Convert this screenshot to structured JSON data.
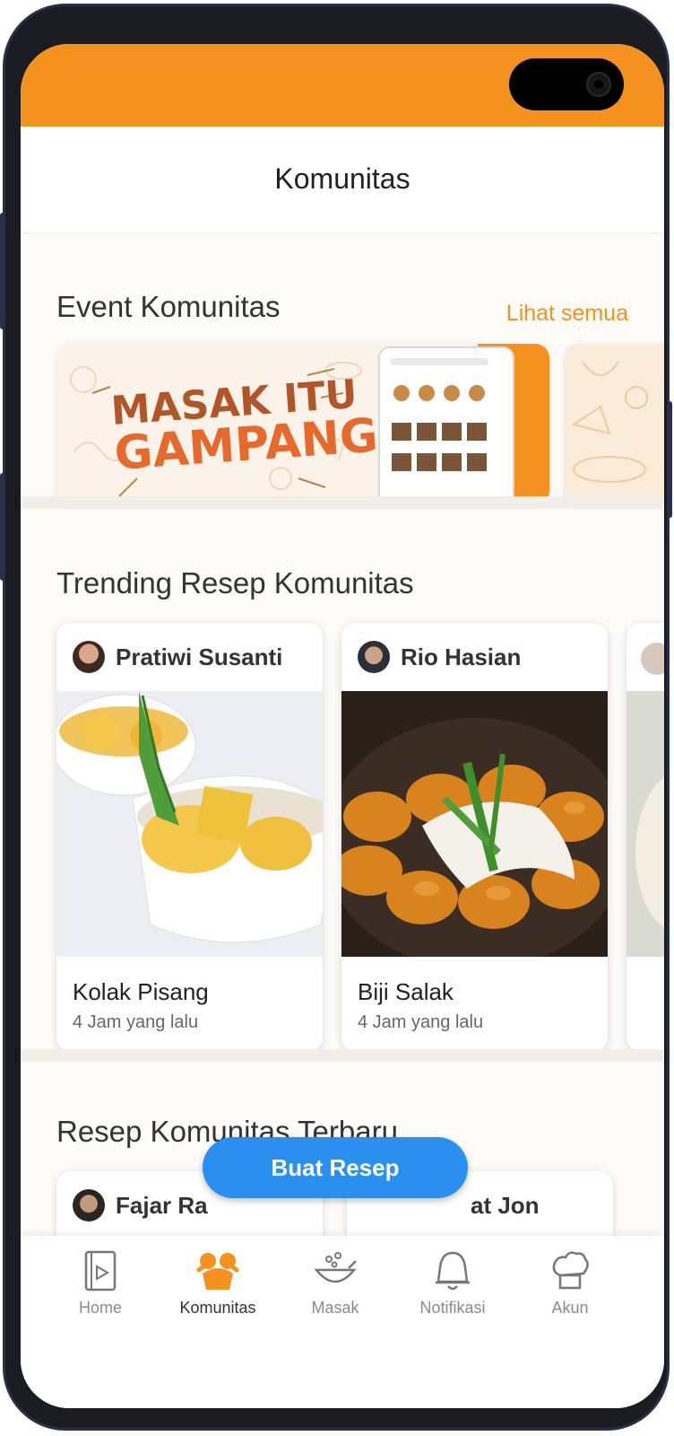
{
  "header": {
    "title": "Komunitas"
  },
  "events": {
    "title": "Event Komunitas",
    "see_all": "Lihat semua",
    "banner": {
      "line1": "MASAK ITU",
      "line2": "GAMPANG"
    }
  },
  "trending": {
    "title": "Trending Resep Komunitas",
    "cards": [
      {
        "author": "Pratiwi Susanti",
        "recipe": "Kolak Pisang",
        "time": "4 Jam yang lalu"
      },
      {
        "author": "Rio Hasian",
        "recipe": "Biji Salak",
        "time": "4 Jam yang lalu"
      }
    ]
  },
  "latest": {
    "title": "Resep Komunitas Terbaru",
    "cards": [
      {
        "author": "Fajar Ra"
      },
      {
        "author": "at Jon"
      }
    ]
  },
  "fab": {
    "label": "Buat Resep"
  },
  "nav": [
    {
      "label": "Home",
      "icon": "book-icon"
    },
    {
      "label": "Komunitas",
      "icon": "chef-hands-icon",
      "active": true
    },
    {
      "label": "Masak",
      "icon": "wok-icon"
    },
    {
      "label": "Notifikasi",
      "icon": "bell-icon"
    },
    {
      "label": "Akun",
      "icon": "chef-hat-icon"
    }
  ],
  "colors": {
    "accent": "#f5921f",
    "fab": "#2b8ff0"
  }
}
